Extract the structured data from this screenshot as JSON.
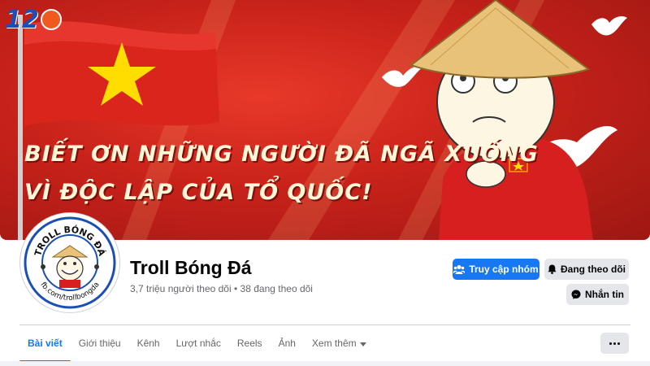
{
  "cover": {
    "brand_logo": "12",
    "headline_line1": "BIẾT ƠN NHỮNG NGƯỜI ĐÃ NGÃ XUỐNG",
    "headline_line2": "VÌ ĐỘC LẬP CỦA TỔ QUỐC!",
    "colors": {
      "flag_red": "#da251d",
      "star_yellow": "#ffdd00"
    }
  },
  "avatar": {
    "ring_text_top": "TROLL BÓNG ĐÁ",
    "ring_text_bottom": "fb.com/trollbongda"
  },
  "profile": {
    "name": "Troll Bóng Đá",
    "followers": "3,7 triệu người theo dõi",
    "separator": "•",
    "following": "38 đang theo dõi"
  },
  "actions": {
    "access_group": {
      "label": "Truy cập nhóm",
      "icon": "group-icon"
    },
    "following": {
      "label": "Đang theo dõi",
      "icon": "bell-icon"
    },
    "message": {
      "label": "Nhắn tin",
      "icon": "messenger-icon"
    }
  },
  "tabs": [
    {
      "label": "Bài viết",
      "active": true
    },
    {
      "label": "Giới thiệu"
    },
    {
      "label": "Kênh"
    },
    {
      "label": "Lượt nhắc"
    },
    {
      "label": "Reels"
    },
    {
      "label": "Ảnh"
    },
    {
      "label": "Xem thêm",
      "icon": "caret-down-icon"
    }
  ],
  "more_menu": {
    "icon": "more-dots-icon"
  },
  "colors": {
    "accent": "#1877f2",
    "secondary_button": "#e4e6eb",
    "muted_text": "#65676b"
  }
}
